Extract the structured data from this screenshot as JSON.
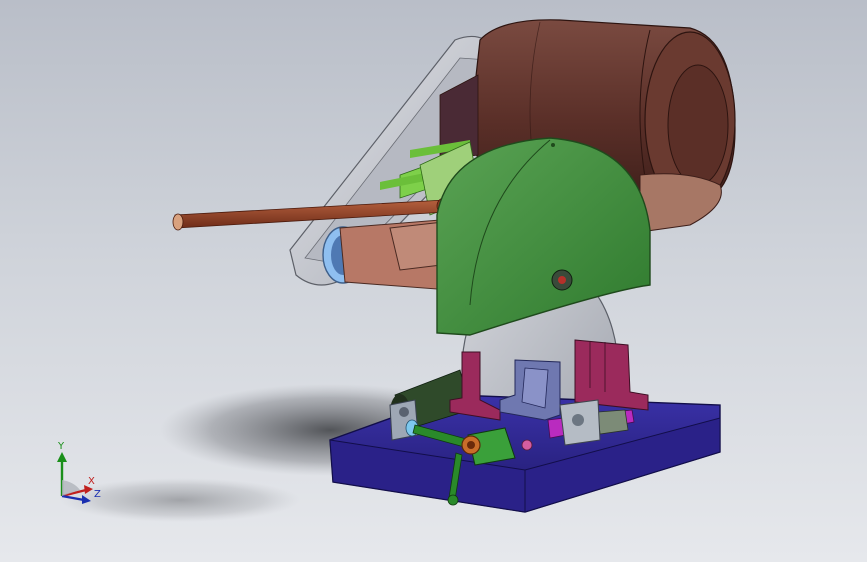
{
  "triad": {
    "x_label": "X",
    "y_label": "Y",
    "z_label": "Z",
    "colors": {
      "x": "#c0201e",
      "y": "#1a8f1a",
      "z": "#1a2fb0"
    }
  },
  "scene": {
    "background_colors": [
      "#b9bec8",
      "#e6e8ec"
    ],
    "part_colors": {
      "motor": "#5a2f28",
      "belt_guard": "#c7c9d0",
      "blade_guard": "#3f8a3c",
      "blade": "#b9bcc4",
      "base_plate": "#2a2188",
      "handle_rod": "#8a3a22",
      "vise_blocks": "#9b2a5c",
      "bracket": "#6f78b0",
      "linkage": "#2a8a2a",
      "spring_rod": "#b92bbf"
    }
  }
}
